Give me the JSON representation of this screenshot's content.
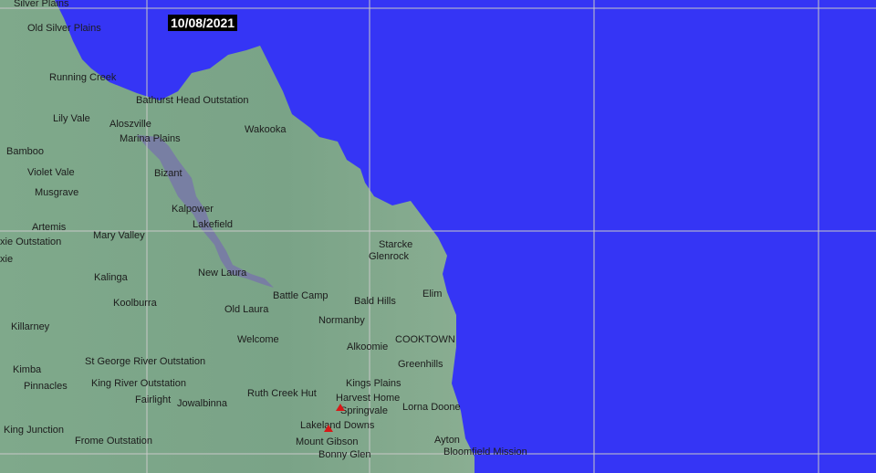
{
  "date_label": "10/08/2021",
  "colors": {
    "ocean": "#3535f5",
    "land": "#7aa688",
    "flood": "#7878a8",
    "grid": "#c8c8c8",
    "marker": "#d81818"
  },
  "places": [
    "Silver Plains",
    "Old Silver Plains",
    "Running Creek",
    "Bathurst Head Outstation",
    "Lily Vale",
    "Aloszville",
    "Marina Plains",
    "Wakooka",
    "Bamboo",
    "Violet Vale",
    "Bizant",
    "Musgrave",
    "Kalpower",
    "Lakefield",
    "Artemis",
    "Mary Valley",
    "xie Outstation",
    "xie",
    "Starcke",
    "Glenrock",
    "Kalinga",
    "New Laura",
    "Battle Camp",
    "Bald Hills",
    "Elim",
    "Koolburra",
    "Old Laura",
    "Normanby",
    "Killarney",
    "Welcome",
    "COOKTOWN",
    "Alkoomie",
    "Greenhills",
    "St George River Outstation",
    "Kimba",
    "King River Outstation",
    "Kings Plains",
    "Pinnacles",
    "Ruth Creek Hut",
    "Harvest Home",
    "Fairlight",
    "Jowalbinna",
    "Lorna Doone",
    "Springvale",
    "Lakeland Downs",
    "King Junction",
    "Frome Outstation",
    "Mount Gibson",
    "Ayton",
    "Bonny Glen",
    "Bloomfield Mission"
  ],
  "markers": [
    "marker-springvale",
    "marker-lakeland-downs"
  ]
}
